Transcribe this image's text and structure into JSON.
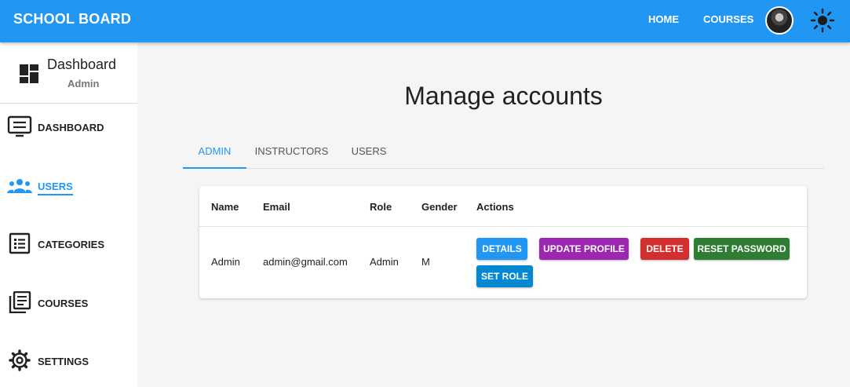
{
  "appbar": {
    "brand": "SCHOOL BOARD",
    "nav": [
      "HOME",
      "COURSES"
    ],
    "theme_icon": "sun-icon",
    "avatar_icon": "user-avatar"
  },
  "sidebar": {
    "header": {
      "title": "Dashboard",
      "subtitle": "Admin",
      "icon": "dashboard-icon"
    },
    "items": [
      {
        "label": "DASHBOARD",
        "icon": "monitor-list-icon",
        "active": false
      },
      {
        "label": "USERS",
        "icon": "users-group-icon",
        "active": true
      },
      {
        "label": "CATEGORIES",
        "icon": "list-icon",
        "active": false
      },
      {
        "label": "COURSES",
        "icon": "library-books-icon",
        "active": false
      },
      {
        "label": "SETTINGS",
        "icon": "gear-icon",
        "active": false
      }
    ]
  },
  "main": {
    "title": "Manage accounts",
    "tabs": [
      "ADMIN",
      "INSTRUCTORS",
      "USERS"
    ],
    "active_tab": "ADMIN",
    "table": {
      "headers": [
        "Name",
        "Email",
        "Role",
        "Gender",
        "Actions"
      ],
      "rows": [
        {
          "name": "Admin",
          "email": "admin@gmail.com",
          "role": "Admin",
          "gender": "M",
          "actions": [
            "DETAILS",
            "UPDATE PROFILE",
            "DELETE",
            "RESET PASSWORD",
            "SET ROLE"
          ]
        }
      ]
    }
  },
  "colors": {
    "primary": "#2196f3",
    "update": "#9c27b0",
    "delete": "#d32f2f",
    "reset": "#2e7d32",
    "set_role": "#0288d1"
  }
}
